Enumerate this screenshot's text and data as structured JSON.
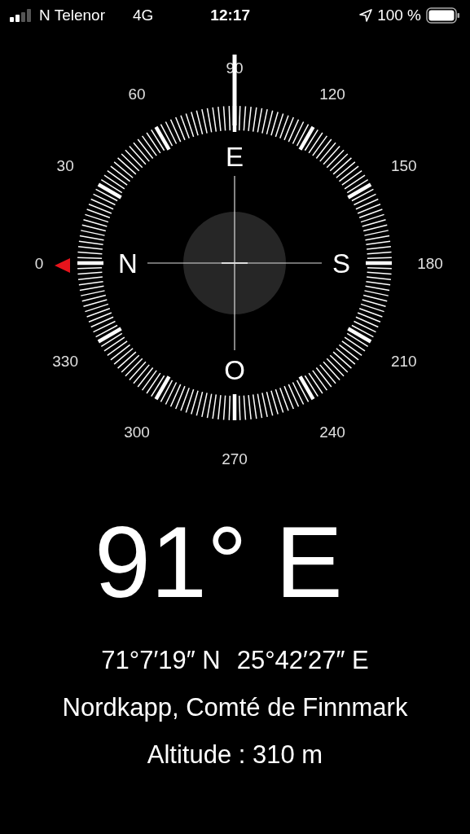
{
  "status_bar": {
    "carrier": "N Telenor",
    "network": "4G",
    "time": "12:17",
    "battery": "100 %"
  },
  "dial": {
    "labels": [
      "0",
      "30",
      "60",
      "90",
      "120",
      "150",
      "180",
      "210",
      "240",
      "270",
      "300",
      "330"
    ],
    "cardinals": [
      "N",
      "E",
      "S",
      "O"
    ]
  },
  "heading": "91° E",
  "coordinates": {
    "latitude": "71°7′19″ N",
    "longitude": "25°42′27″ E"
  },
  "place": "Nordkapp, Comté de Finnmark",
  "altitude": "Altitude : 310 m"
}
